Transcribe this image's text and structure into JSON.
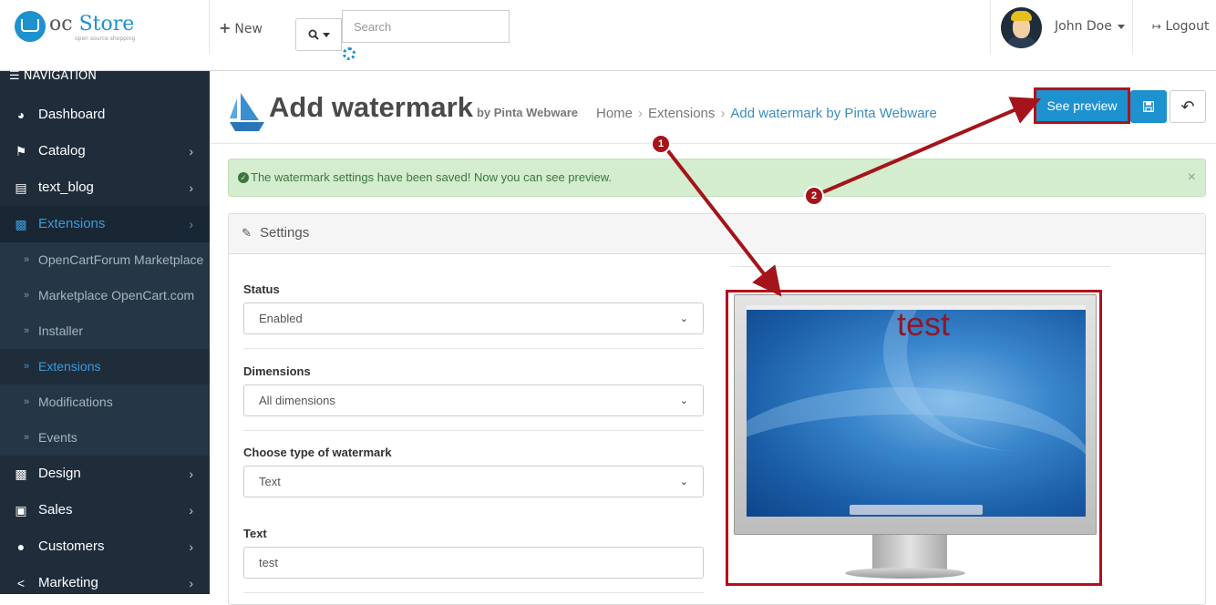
{
  "header": {
    "logo_text_prefix": "oc",
    "logo_text_main": "Store",
    "logo_sub": "open source shopping",
    "new_label": "New",
    "search_placeholder": "Search",
    "user_name": "John Doe",
    "logout_label": "Logout"
  },
  "sidebar": {
    "title": "NAVIGATION",
    "items": [
      {
        "label": "Dashboard",
        "icon": "dashboard-icon"
      },
      {
        "label": "Catalog",
        "icon": "tag-icon"
      },
      {
        "label": "text_blog",
        "icon": "book-icon"
      },
      {
        "label": "Extensions",
        "icon": "puzzle-icon"
      }
    ],
    "sub_items": [
      "OpenCartForum Marketplace",
      "Marketplace OpenCart.com",
      "Installer",
      "Extensions",
      "Modifications",
      "Events"
    ],
    "items_after": [
      {
        "label": "Design",
        "icon": "monitor-icon"
      },
      {
        "label": "Sales",
        "icon": "cart-icon"
      },
      {
        "label": "Customers",
        "icon": "user-icon"
      },
      {
        "label": "Marketing",
        "icon": "share-icon"
      }
    ]
  },
  "page": {
    "title": "Add watermark",
    "title_small": "by Pinta Webware",
    "breadcrumb": [
      "Home",
      "Extensions",
      "Add watermark by Pinta Webware"
    ],
    "preview_button": "See preview",
    "alert": "The watermark settings have been saved! Now you can see preview.",
    "panel_title": "Settings"
  },
  "form": {
    "status_label": "Status",
    "status_value": "Enabled",
    "dimensions_label": "Dimensions",
    "dimensions_value": "All dimensions",
    "type_label": "Choose type of watermark",
    "type_value": "Text",
    "text_label": "Text",
    "text_value": "test"
  },
  "preview": {
    "watermark_text": "test"
  },
  "annotations": [
    "1",
    "2"
  ],
  "colors": {
    "accent": "#1e91cf",
    "sidebar_bg": "#1f2d3b",
    "annotation_red": "#a4141a",
    "alert_bg": "#d4edcf"
  }
}
